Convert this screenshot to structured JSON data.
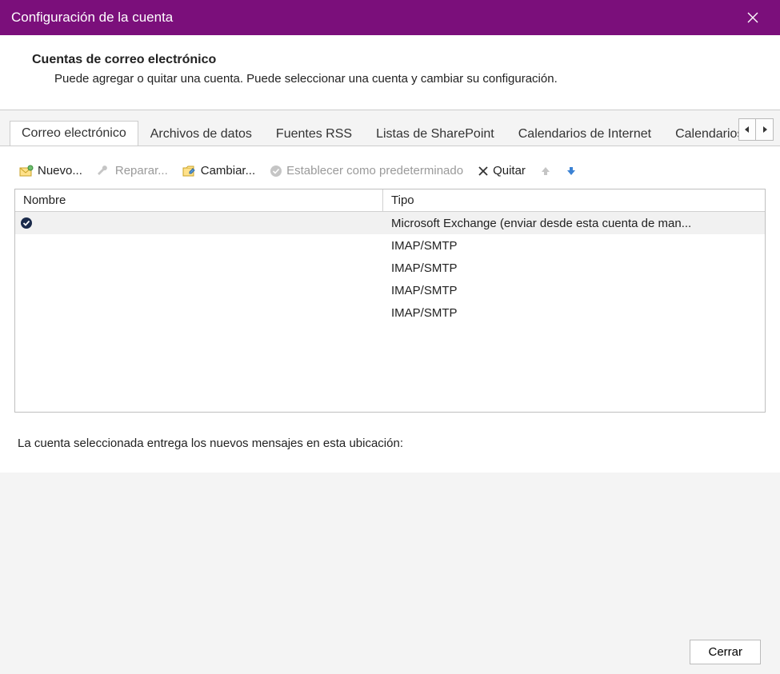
{
  "window": {
    "title": "Configuración de la cuenta"
  },
  "intro": {
    "title": "Cuentas de correo electrónico",
    "desc": "Puede agregar o quitar una cuenta. Puede seleccionar una cuenta y cambiar su configuración."
  },
  "tabs": [
    {
      "label": "Correo electrónico",
      "active": true
    },
    {
      "label": "Archivos de datos"
    },
    {
      "label": "Fuentes RSS"
    },
    {
      "label": "Listas de SharePoint"
    },
    {
      "label": "Calendarios de Internet"
    },
    {
      "label": "Calendarios p"
    }
  ],
  "toolbar": {
    "new": "Nuevo...",
    "repair": "Reparar...",
    "change": "Cambiar...",
    "set_default": "Establecer como predeterminado",
    "remove": "Quitar"
  },
  "grid": {
    "headers": {
      "name": "Nombre",
      "type": "Tipo"
    },
    "rows": [
      {
        "name": "",
        "type": "Microsoft Exchange (enviar desde esta cuenta de man...",
        "default": true,
        "selected": true
      },
      {
        "name": "",
        "type": "IMAP/SMTP"
      },
      {
        "name": "",
        "type": "IMAP/SMTP"
      },
      {
        "name": "",
        "type": "IMAP/SMTP"
      },
      {
        "name": "",
        "type": "IMAP/SMTP"
      }
    ]
  },
  "delivery_note": "La cuenta seleccionada entrega los nuevos mensajes en esta ubicación:",
  "footer": {
    "close": "Cerrar"
  }
}
